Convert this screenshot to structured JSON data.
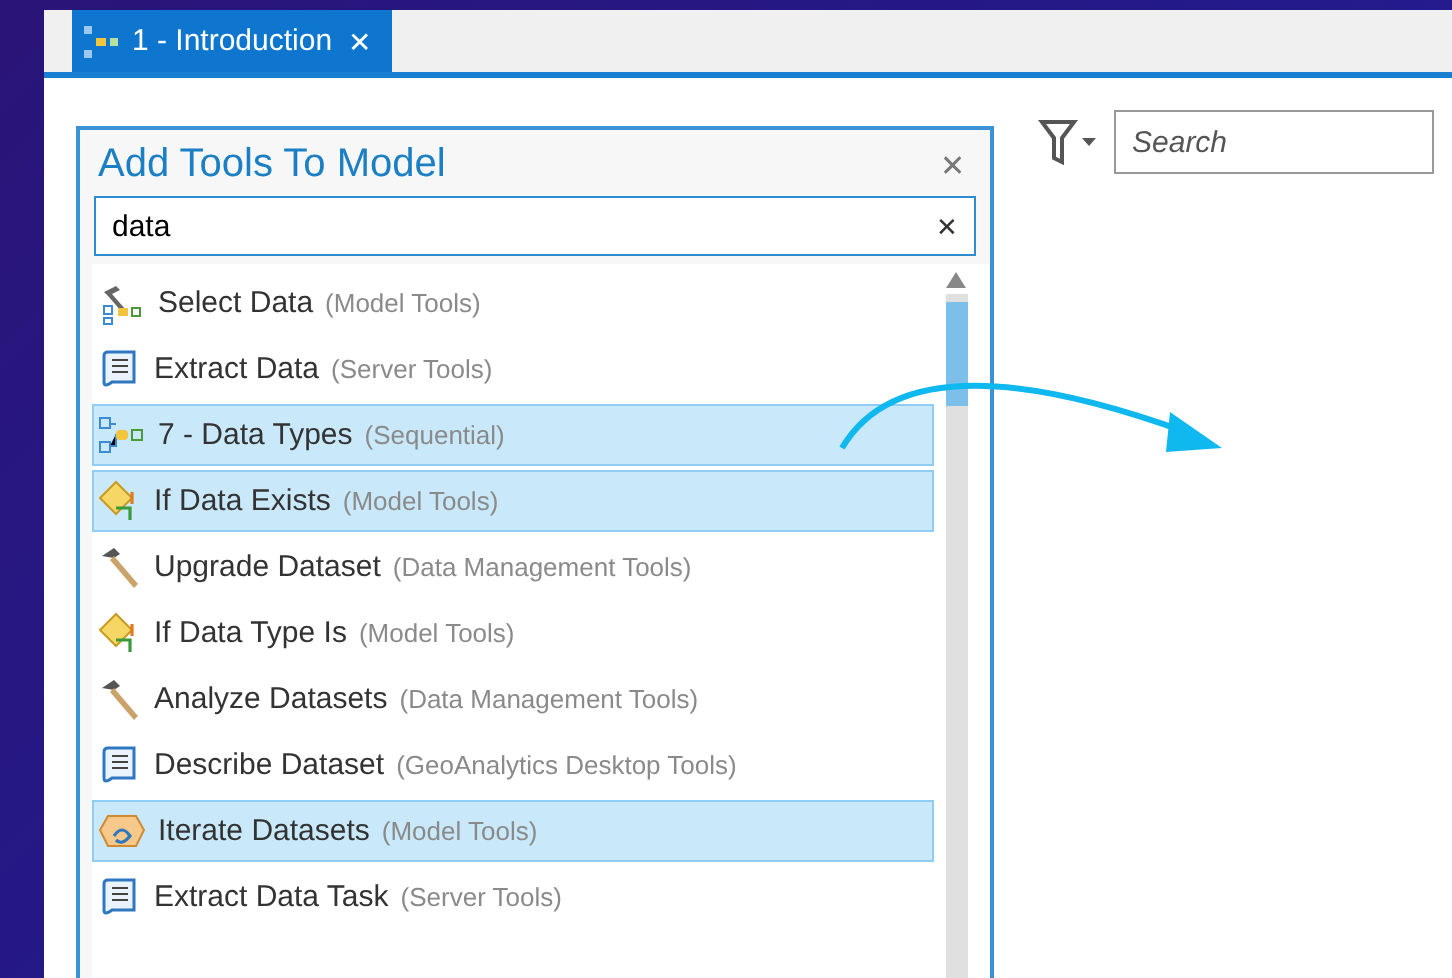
{
  "tab": {
    "label": "1 - Introduction",
    "close": "✕",
    "selected": true
  },
  "dialog": {
    "title": "Add Tools To Model",
    "close": "✕",
    "search": {
      "value": "data",
      "clear": "✕"
    },
    "items": [
      {
        "name": "Select Data",
        "toolbox": "(Model Tools)",
        "kind": "model-tool",
        "selected": false
      },
      {
        "name": "Extract Data",
        "toolbox": "(Server Tools)",
        "kind": "script",
        "selected": false
      },
      {
        "name": "7 - Data Types",
        "toolbox": "(Sequential)",
        "kind": "model",
        "selected": true
      },
      {
        "name": "If Data Exists",
        "toolbox": "(Model Tools)",
        "kind": "condition",
        "selected": true
      },
      {
        "name": "Upgrade Dataset",
        "toolbox": "(Data Management Tools)",
        "kind": "hammer",
        "selected": false
      },
      {
        "name": "If Data Type Is",
        "toolbox": "(Model Tools)",
        "kind": "condition",
        "selected": false
      },
      {
        "name": "Analyze Datasets",
        "toolbox": "(Data Management Tools)",
        "kind": "hammer",
        "selected": false
      },
      {
        "name": "Describe Dataset",
        "toolbox": "(GeoAnalytics Desktop Tools)",
        "kind": "script",
        "selected": false
      },
      {
        "name": "Iterate Datasets",
        "toolbox": "(Model Tools)",
        "kind": "iterator",
        "selected": true
      },
      {
        "name": "Extract Data Task",
        "toolbox": "(Server Tools)",
        "kind": "script",
        "selected": false
      }
    ]
  },
  "canvas_search": {
    "placeholder": "Search"
  }
}
